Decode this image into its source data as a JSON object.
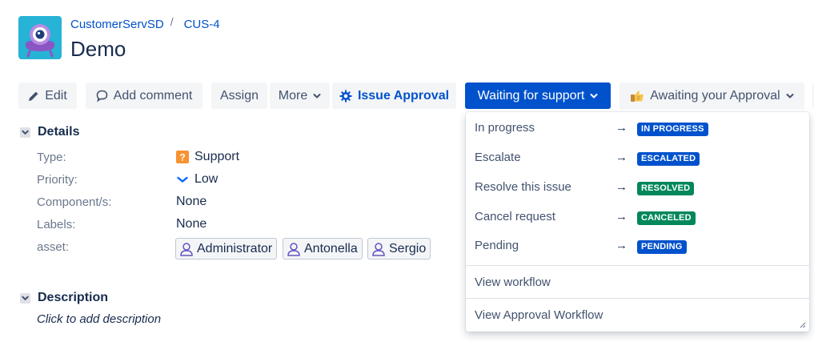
{
  "breadcrumb": {
    "project": "CustomerServSD",
    "separator": "/",
    "issue_key": "CUS-4"
  },
  "issue": {
    "title": "Demo"
  },
  "toolbar": {
    "edit": "Edit",
    "add_comment": "Add comment",
    "assign": "Assign",
    "more": "More",
    "issue_approval": "Issue Approval",
    "status": "Waiting for support",
    "awaiting_approval": "Awaiting your Approval"
  },
  "details": {
    "heading": "Details",
    "type_label": "Type:",
    "type_value": "Support",
    "priority_label": "Priority:",
    "priority_value": "Low",
    "components_label": "Component/s:",
    "components_value": "None",
    "labels_label": "Labels:",
    "labels_value": "None",
    "asset_label": "asset:",
    "assets": [
      "Administrator",
      "Antonella",
      "Sergio"
    ]
  },
  "description": {
    "heading": "Description",
    "placeholder": "Click to add description"
  },
  "transitions": [
    {
      "label": "In progress",
      "arrow": "→",
      "status": "IN PROGRESS",
      "color": "#0052cc"
    },
    {
      "label": "Escalate",
      "arrow": "→",
      "status": "ESCALATED",
      "color": "#0052cc"
    },
    {
      "label": "Resolve this issue",
      "arrow": "→",
      "status": "RESOLVED",
      "color": "#00875a"
    },
    {
      "label": "Cancel request",
      "arrow": "→",
      "status": "CANCELED",
      "color": "#00875a"
    },
    {
      "label": "Pending",
      "arrow": "→",
      "status": "PENDING",
      "color": "#0052cc"
    }
  ],
  "dropdown_links": {
    "view_workflow": "View workflow",
    "view_approval_workflow": "View Approval Workflow"
  },
  "colors": {
    "primary": "#0052cc",
    "done_green": "#00875a",
    "neutral_bg": "#f4f5f7",
    "text": "#172b4d"
  }
}
